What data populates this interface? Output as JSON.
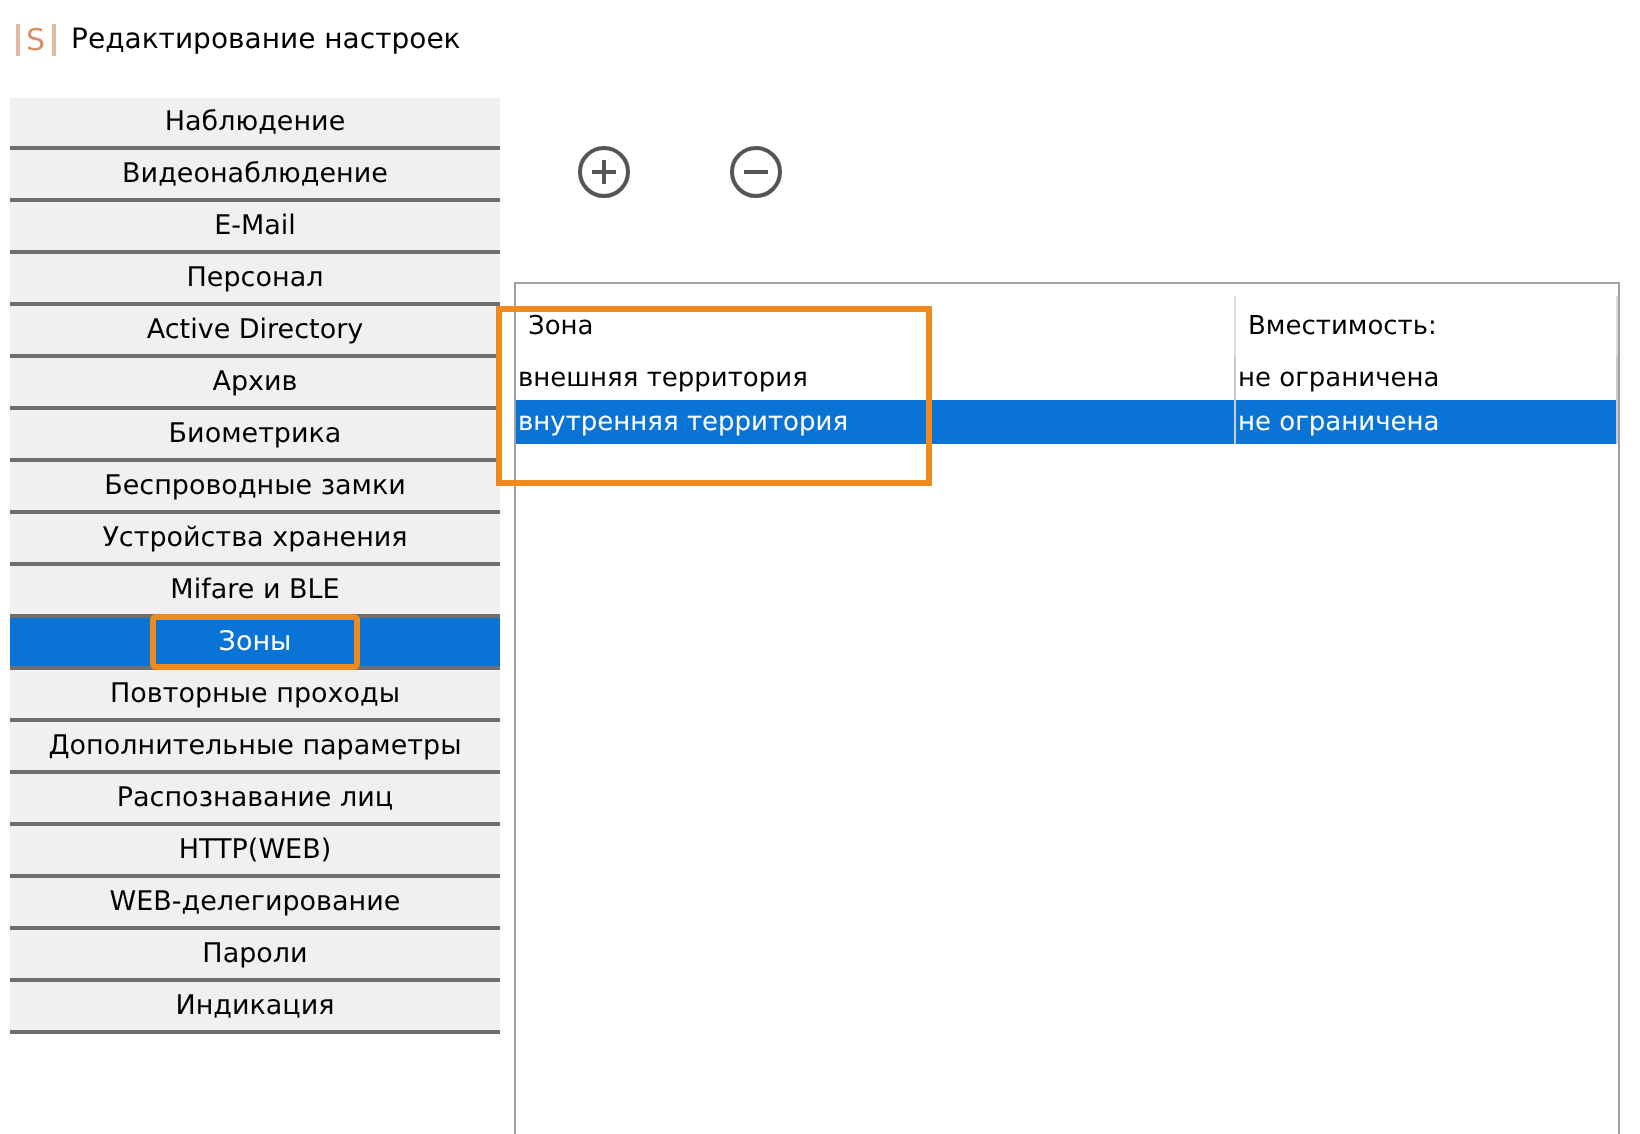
{
  "window": {
    "logo": "S",
    "title": "Редактирование настроек"
  },
  "sidebar": {
    "items": [
      {
        "label": "Наблюдение",
        "selected": false,
        "highlighted": false
      },
      {
        "label": "Видеонаблюдение",
        "selected": false,
        "highlighted": false
      },
      {
        "label": "E-Mail",
        "selected": false,
        "highlighted": false
      },
      {
        "label": "Персонал",
        "selected": false,
        "highlighted": false
      },
      {
        "label": "Active Directory",
        "selected": false,
        "highlighted": false
      },
      {
        "label": "Архив",
        "selected": false,
        "highlighted": false
      },
      {
        "label": "Биометрика",
        "selected": false,
        "highlighted": false
      },
      {
        "label": "Беспроводные замки",
        "selected": false,
        "highlighted": false
      },
      {
        "label": "Устройства хранения",
        "selected": false,
        "highlighted": false
      },
      {
        "label": "Mifare и BLE",
        "selected": false,
        "highlighted": false
      },
      {
        "label": "Зоны",
        "selected": true,
        "highlighted": true
      },
      {
        "label": "Повторные проходы",
        "selected": false,
        "highlighted": false
      },
      {
        "label": "Дополнительные параметры",
        "selected": false,
        "highlighted": false
      },
      {
        "label": "Распознавание лиц",
        "selected": false,
        "highlighted": false
      },
      {
        "label": "HTTP(WEB)",
        "selected": false,
        "highlighted": false
      },
      {
        "label": "WEB-делегирование",
        "selected": false,
        "highlighted": false
      },
      {
        "label": "Пароли",
        "selected": false,
        "highlighted": false
      },
      {
        "label": "Индикация",
        "selected": false,
        "highlighted": false
      }
    ]
  },
  "toolbar": {
    "buttons": [
      {
        "kind": "add"
      },
      {
        "kind": "remove"
      }
    ]
  },
  "table": {
    "columns": [
      "Зона",
      "Вместимость:"
    ],
    "first_column_highlighted": true,
    "rows": [
      {
        "cells": [
          "внешняя территория",
          "не ограничена"
        ],
        "selected": false
      },
      {
        "cells": [
          "внутренняя территория",
          "не ограничена"
        ],
        "selected": true
      }
    ]
  }
}
